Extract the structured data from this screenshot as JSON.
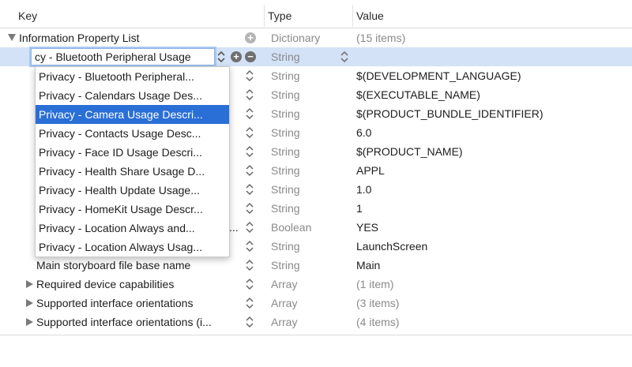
{
  "header": {
    "key": "Key",
    "type": "Type",
    "value": "Value"
  },
  "root": {
    "key": "Information Property List",
    "type": "Dictionary",
    "value": "(15 items)"
  },
  "editing_row": {
    "key_value": "cy - Bluetooth Peripheral Usage",
    "type": "String"
  },
  "hidden_rows": [
    {
      "type": "String",
      "value": "$(DEVELOPMENT_LANGUAGE)"
    },
    {
      "type": "String",
      "value": "$(EXECUTABLE_NAME)"
    },
    {
      "type": "String",
      "value": "$(PRODUCT_BUNDLE_IDENTIFIER)"
    },
    {
      "type": "String",
      "value": "6.0"
    },
    {
      "type": "String",
      "value": "$(PRODUCT_NAME)"
    },
    {
      "type": "String",
      "value": "APPL"
    },
    {
      "type": "String",
      "value": "1.0"
    },
    {
      "type": "String",
      "value": "1"
    },
    {
      "type": "Boolean",
      "value": "YES",
      "key_fragment": "..."
    },
    {
      "type": "String",
      "value": "LaunchScreen"
    }
  ],
  "rows": [
    {
      "key": "Main storyboard file base name",
      "type": "String",
      "value": "Main"
    },
    {
      "key": "Required device capabilities",
      "type": "Array",
      "value": "(1 item)"
    },
    {
      "key": "Supported interface orientations",
      "type": "Array",
      "value": "(3 items)"
    },
    {
      "key": "Supported interface orientations (i...",
      "type": "Array",
      "value": "(4 items)"
    }
  ],
  "popup_items": [
    "Privacy - Bluetooth Peripheral...",
    "Privacy - Calendars Usage Des...",
    "Privacy - Camera Usage Descri...",
    "Privacy - Contacts Usage Desc...",
    "Privacy - Face ID Usage Descri...",
    "Privacy - Health Share Usage D...",
    "Privacy - Health Update Usage...",
    "Privacy - HomeKit Usage Descr...",
    "Privacy - Location Always and...",
    "Privacy - Location Always Usag..."
  ],
  "popup_selected": "Privacy - Camera Usage Descri...",
  "colors": {
    "selection": "#d3e2f6",
    "highlight": "#2a6fd6",
    "muted_text": "#8a8a8a"
  }
}
